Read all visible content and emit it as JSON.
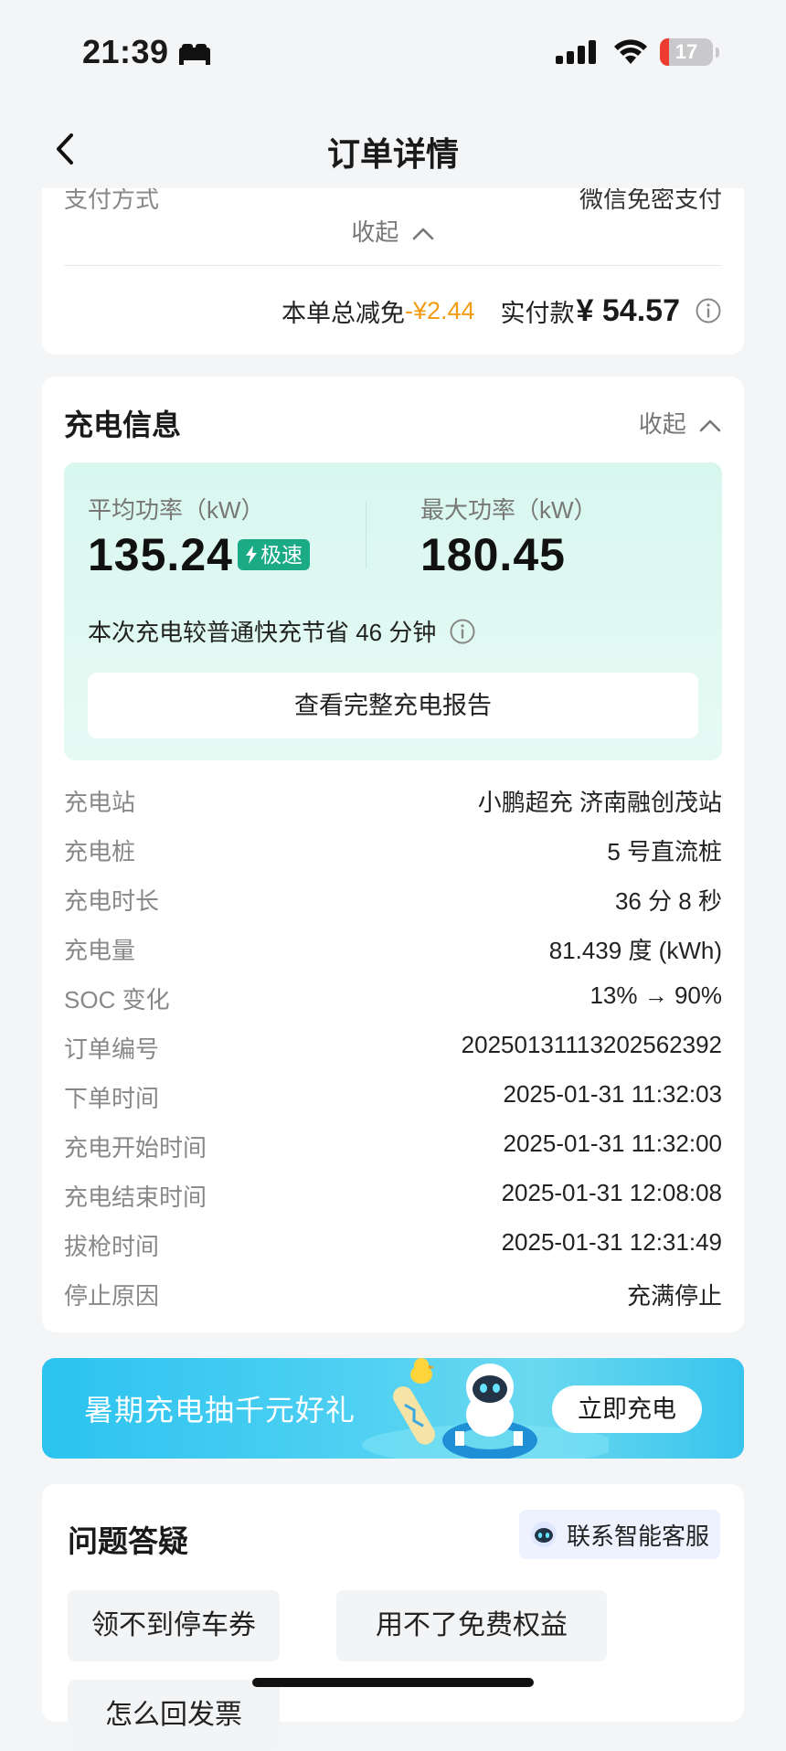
{
  "status_bar": {
    "time": "21:39",
    "battery": "17",
    "battery_level": 0.17,
    "battery_color": "#ee3b30"
  },
  "nav": {
    "title": "订单详情"
  },
  "payment": {
    "method_label": "支付方式",
    "method_value": "微信免密支付",
    "collapse_label": "收起",
    "discount_label": "本单总减免",
    "discount_value": "-¥2.44",
    "paid_label": "实付款",
    "paid_value": "¥ 54.57"
  },
  "charge_info": {
    "title": "充电信息",
    "collapse_label": "收起",
    "avg_power_label": "平均功率（kW）",
    "avg_power_value": "135.24",
    "fast_badge": "极速",
    "max_power_label": "最大功率（kW）",
    "max_power_value": "180.45",
    "saving_text": "本次充电较普通快充节省 46 分钟",
    "report_button": "查看完整充电报告",
    "accent_color": "#1aaa86",
    "details": [
      {
        "label": "充电站",
        "value": "小鹏超充 济南融创茂站"
      },
      {
        "label": "充电桩",
        "value": "5 号直流桩"
      },
      {
        "label": "充电时长",
        "value": "36 分 8 秒"
      },
      {
        "label": "充电量",
        "value": "81.439 度 (kWh)"
      },
      {
        "label": "SOC 变化",
        "value": "13% → 90%"
      },
      {
        "label": "订单编号",
        "value": "20250131113202562392"
      },
      {
        "label": "下单时间",
        "value": "2025-01-31 11:32:03"
      },
      {
        "label": "充电开始时间",
        "value": "2025-01-31 11:32:00"
      },
      {
        "label": "充电结束时间",
        "value": "2025-01-31 12:08:08"
      },
      {
        "label": "拔枪时间",
        "value": "2025-01-31 12:31:49"
      },
      {
        "label": "停止原因",
        "value": "充满停止"
      }
    ]
  },
  "banner": {
    "text": "暑期充电抽千元好礼",
    "button": "立即充电"
  },
  "qa": {
    "title": "问题答疑",
    "service_button": "联系智能客服",
    "chips": [
      "领不到停车券",
      "用不了免费权益",
      "怎么回发票"
    ]
  }
}
